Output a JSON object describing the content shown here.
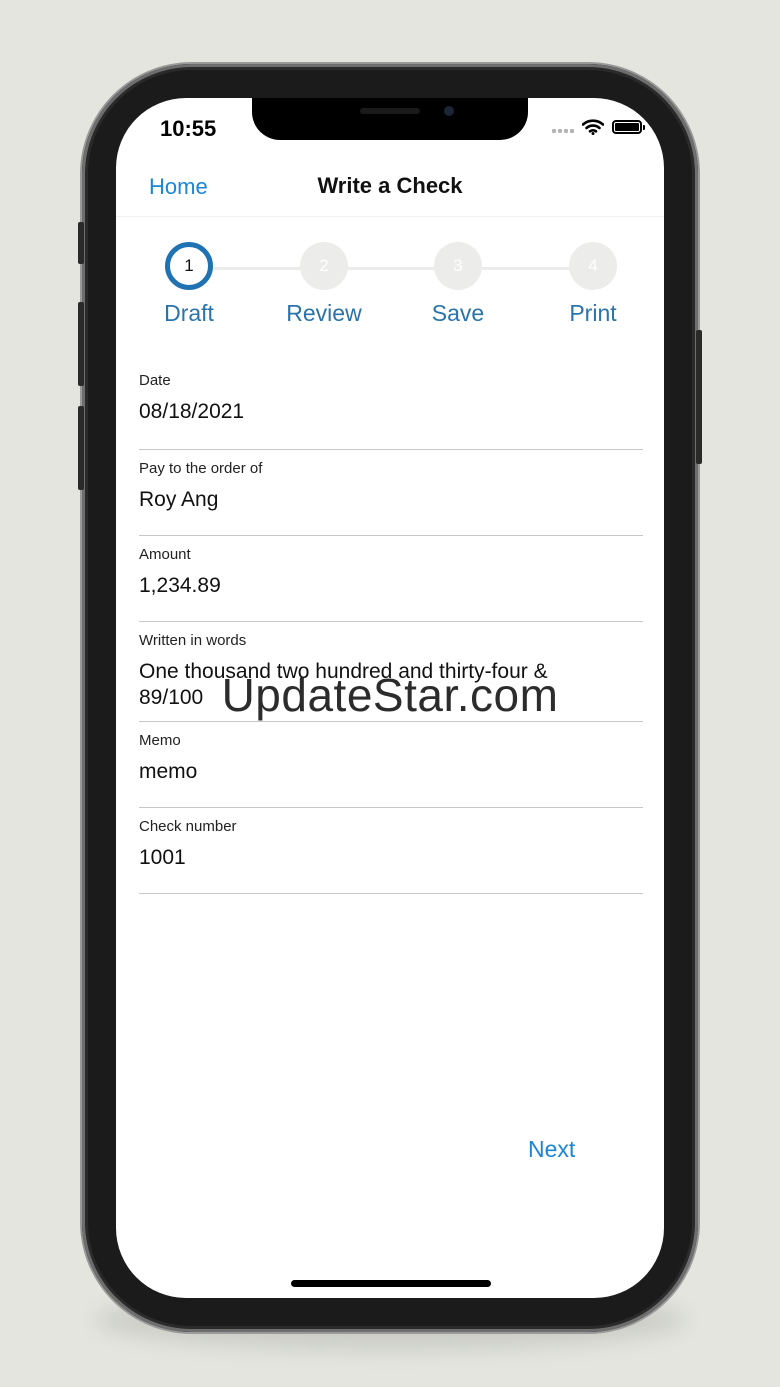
{
  "status_bar": {
    "time": "10:55"
  },
  "nav": {
    "home_label": "Home",
    "title": "Write a Check"
  },
  "stepper": {
    "steps": [
      {
        "number": "1",
        "label": "Draft",
        "active": true
      },
      {
        "number": "2",
        "label": "Review",
        "active": false
      },
      {
        "number": "3",
        "label": "Save",
        "active": false
      },
      {
        "number": "4",
        "label": "Print",
        "active": false
      }
    ]
  },
  "form": {
    "date": {
      "label": "Date",
      "value": "08/18/2021"
    },
    "payee": {
      "label": "Pay to the order of",
      "value": "Roy Ang"
    },
    "amount": {
      "label": "Amount",
      "value": "1,234.89"
    },
    "words": {
      "label": "Written in words",
      "line1": "One thousand two hundred and thirty-four &",
      "line2": "89/100"
    },
    "memo": {
      "label": "Memo",
      "value": "memo"
    },
    "check_number": {
      "label": "Check number",
      "value": "1001"
    }
  },
  "footer": {
    "next_label": "Next"
  },
  "watermark": "UpdateStar.com",
  "colors": {
    "link": "#1a86d6",
    "step_active": "#2073b2",
    "step_label": "#2a73ab",
    "background": "#e3e5de"
  },
  "icons": [
    "signal-icon",
    "wifi-icon",
    "battery-icon"
  ]
}
